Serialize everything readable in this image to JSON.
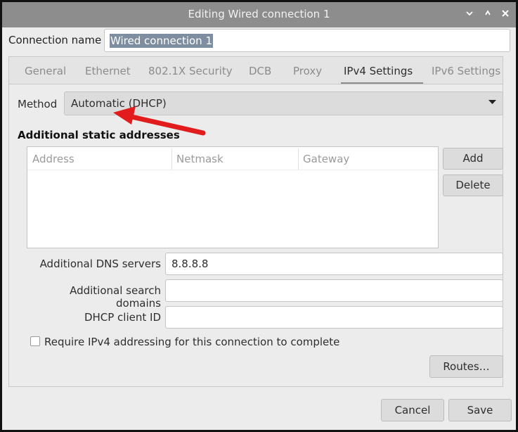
{
  "window": {
    "title": "Editing Wired connection 1"
  },
  "connection": {
    "label": "Connection name",
    "value": "Wired connection 1"
  },
  "tabs": [
    {
      "label": "General",
      "active": false
    },
    {
      "label": "Ethernet",
      "active": false
    },
    {
      "label": "802.1X Security",
      "active": false
    },
    {
      "label": "DCB",
      "active": false
    },
    {
      "label": "Proxy",
      "active": false
    },
    {
      "label": "IPv4 Settings",
      "active": true
    },
    {
      "label": "IPv6 Settings",
      "active": false
    }
  ],
  "ipv4": {
    "method_label": "Method",
    "method_value": "Automatic (DHCP)",
    "static_title": "Additional static addresses",
    "columns": [
      "Address",
      "Netmask",
      "Gateway"
    ],
    "add_label": "Add",
    "delete_label": "Delete",
    "dns_label": "Additional DNS servers",
    "dns_value": "8.8.8.8",
    "search_label": "Additional search domains",
    "search_value": "",
    "dhcp_label": "DHCP client ID",
    "dhcp_value": "",
    "require_label": "Require IPv4 addressing for this connection to complete",
    "require_checked": false,
    "routes_label": "Routes…"
  },
  "footer": {
    "cancel_label": "Cancel",
    "save_label": "Save"
  },
  "colors": {
    "titlebar": "#8d8d8d",
    "window_bg": "#ececec",
    "arrow": "#e21c1c"
  },
  "icons": {
    "minimize": "chevron-down-icon",
    "maximize": "maximize-icon",
    "close": "close-icon",
    "dropdown": "triangle-down-icon"
  }
}
